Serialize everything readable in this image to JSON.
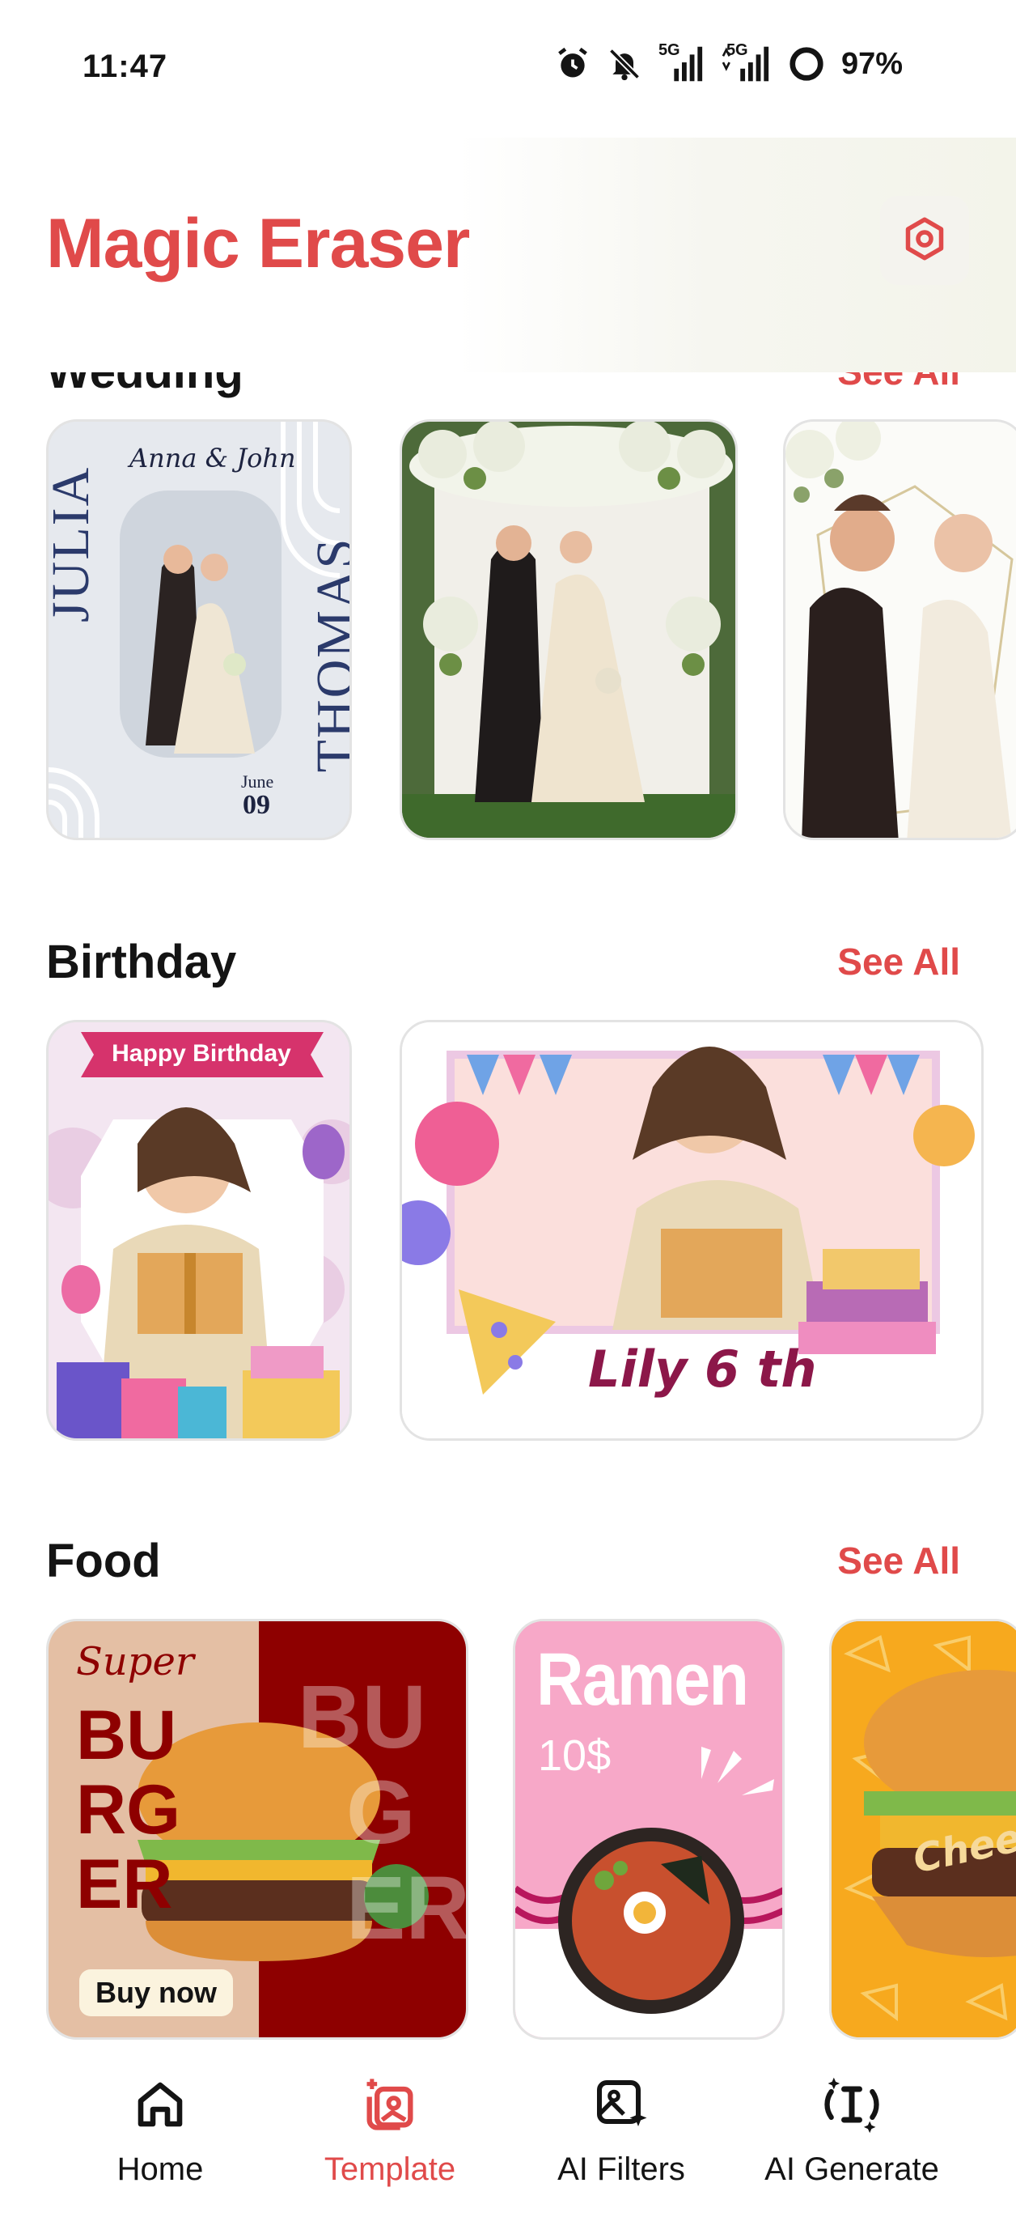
{
  "status_bar": {
    "time": "11:47",
    "signal1": "5G",
    "signal2": "5G",
    "battery": "97%",
    "icons": [
      "alarm-icon",
      "bell-off-icon",
      "signal-5g-icon",
      "signal-5g-icon",
      "battery-ring-icon"
    ]
  },
  "header": {
    "title": "Magic Eraser",
    "settings_icon": "settings-hexagon-icon"
  },
  "sections": {
    "wedding": {
      "title": "Wedding",
      "see_all": "See All",
      "cards": [
        {
          "left_name": "JULIA",
          "right_name": "THOMAS",
          "couple": "Anna & John",
          "month": "June",
          "day": "09"
        },
        {
          "name": "wedding-arch"
        },
        {
          "name": "wedding-floral"
        }
      ]
    },
    "birthday": {
      "title": "Birthday",
      "see_all": "See All",
      "cards": [
        {
          "banner": "Happy Birthday"
        },
        {
          "caption": "Lily 6 th"
        }
      ]
    },
    "food": {
      "title": "Food",
      "see_all": "See All",
      "cards": [
        {
          "script": "Super",
          "word_lines": [
            "BU",
            "RG",
            "ER"
          ],
          "ghost_lines": [
            "BU",
            "G",
            "ER"
          ],
          "button": "Buy now"
        },
        {
          "title": "Ramen",
          "price": "10$"
        },
        {
          "label": "Chees"
        }
      ]
    }
  },
  "colors": {
    "accent": "#e04a4a",
    "text": "#141414",
    "burger_red": "#8e0000",
    "ramen_pink": "#f7a8c8",
    "cheese_orange": "#f7a91e"
  },
  "bottom_nav": {
    "items": [
      {
        "label": "Home",
        "icon": "home-icon",
        "active": false
      },
      {
        "label": "Template",
        "icon": "template-icon",
        "active": true
      },
      {
        "label": "AI Filters",
        "icon": "ai-filters-icon",
        "active": false
      },
      {
        "label": "AI Generate",
        "icon": "ai-generate-icon",
        "active": false
      }
    ]
  }
}
